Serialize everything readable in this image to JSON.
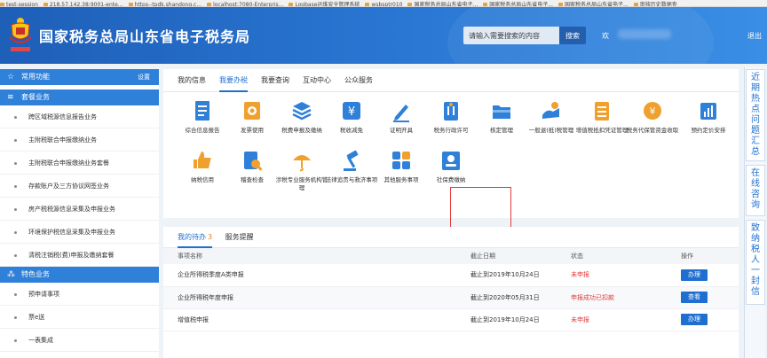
{
  "bookmarks": [
    "test-session",
    "218.57.142.38:9001-ente...",
    "https--tpdk.shandong.c...",
    "localhost:7080-Enterpris...",
    "Logbase运维安全管理系统",
    "wsbsptr010",
    "国家税务总局山东省电子...",
    "国家税务总局山东省电子...",
    "国家税务总局山东省电子...",
    "审核历史数据查"
  ],
  "header": {
    "title": "国家税务总局山东省电子税务局",
    "search_placeholder": "请输入需要搜索的内容",
    "search_button": "搜索",
    "welcome": "欢",
    "logout": "退出"
  },
  "sidebar": {
    "common": {
      "label": "常用功能",
      "setting": "设置"
    },
    "package": {
      "label": "套餐业务"
    },
    "package_items": [
      "跨区域税源信息报告业务",
      "主附税联合申报缴纳业务",
      "主附税联合申报缴纳业务套餐",
      "存款账户及三方协议网签业务",
      "房产税税源信息采集及申报业务",
      "环境保护税信息采集及申报业务",
      "清税注销税(费)申报及缴纳套餐"
    ],
    "feature": {
      "label": "特色业务"
    },
    "feature_items": [
      "预申请事项",
      "票e送",
      "一表集成"
    ]
  },
  "tabs": [
    "我的信息",
    "我要办税",
    "我要查询",
    "互动中心",
    "公众服务"
  ],
  "active_tab": "我要办税",
  "services": [
    {
      "label": "综合信息报告",
      "icon": "document-list-icon",
      "color": "#2f80d8"
    },
    {
      "label": "发票使用",
      "icon": "invoice-icon",
      "color": "#f0a02c"
    },
    {
      "label": "税费申报及缴纳",
      "icon": "stack-icon",
      "color": "#2f80d8"
    },
    {
      "label": "税收减免",
      "icon": "yuan-icon",
      "color": "#2f80d8"
    },
    {
      "label": "证明开具",
      "icon": "pen-icon",
      "color": "#2f80d8"
    },
    {
      "label": "税务行政许可",
      "icon": "license-icon",
      "color": "#2f80d8"
    },
    {
      "label": "核定管理",
      "icon": "folder-icon",
      "color": "#2f80d8"
    },
    {
      "label": "一般退(抵)税管理",
      "icon": "refund-icon",
      "color": "#2f80d8"
    },
    {
      "label": "增值税抵扣凭证管理",
      "icon": "voucher-icon",
      "color": "#f0a02c"
    },
    {
      "label": "税务代保管资金收取",
      "icon": "funds-icon",
      "color": "#f0a02c"
    },
    {
      "label": "预约定价安排",
      "icon": "chart-icon",
      "color": "#2f80d8"
    },
    {
      "label": "纳税信用",
      "icon": "thumbs-up-icon",
      "color": "#f0a02c"
    },
    {
      "label": "稽查检查",
      "icon": "inspection-icon",
      "color": "#2f80d8"
    },
    {
      "label": "涉税专业服务机构管理",
      "icon": "umbrella-icon",
      "color": "#f0a02c"
    },
    {
      "label": "法律追责与救济事项",
      "icon": "gavel-icon",
      "color": "#2f80d8"
    },
    {
      "label": "其他服务事项",
      "icon": "grid-icon",
      "color": "#2f80d8"
    },
    {
      "label": "社保费缴纳",
      "icon": "social-security-icon",
      "color": "#2f80d8"
    }
  ],
  "todo": {
    "tab_label": "我的待办",
    "count": "3",
    "reminder_label": "服务提醒",
    "columns": [
      "事项名称",
      "截止日期",
      "状态",
      "操作"
    ],
    "rows": [
      {
        "name": "企业所得税季度A类申报",
        "deadline": "截止到2019年10月24日",
        "status": "未申报",
        "action": "办理"
      },
      {
        "name": "企业所得税年度申报",
        "deadline": "截止到2020年05月31日",
        "status": "申报成功已扣款",
        "action": "查看"
      },
      {
        "name": "增值税申报",
        "deadline": "截止到2019年10月24日",
        "status": "未申报",
        "action": "办理"
      }
    ]
  },
  "float_panel": [
    "近期热点问题汇总",
    "在线咨询",
    "致纳税人一封信"
  ],
  "colors": {
    "accent": "#1f6fd1",
    "header": "#2a78d4",
    "status_red": "#e23b3b",
    "highlight": "#e23b3b"
  }
}
